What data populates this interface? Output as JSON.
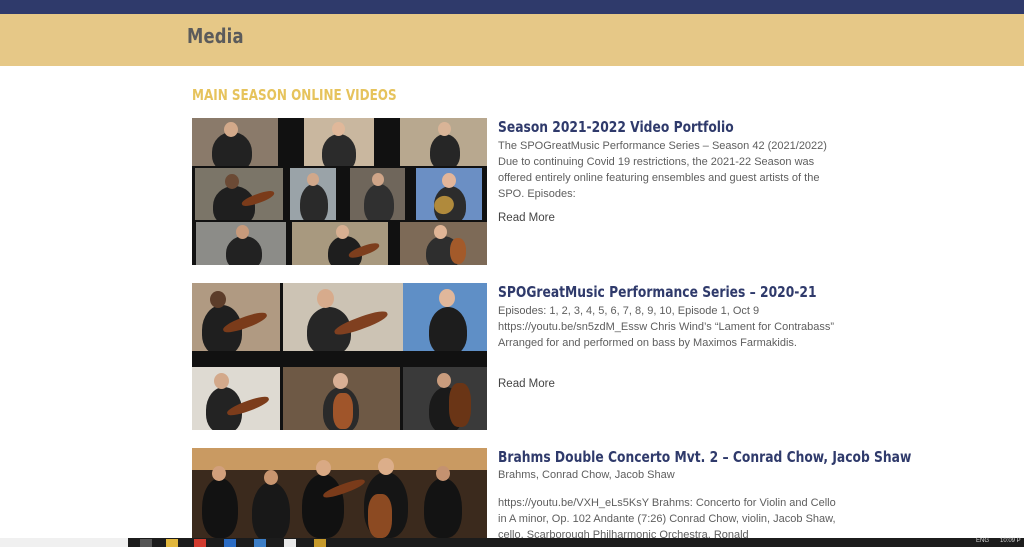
{
  "header": {
    "title": "Media"
  },
  "section": {
    "heading": "MAIN SEASON ONLINE VIDEOS"
  },
  "entries": [
    {
      "title": "Season 2021-2022 Video Portfolio",
      "excerpt": "The SPOGreatMusic Performance Series – Season 42 (2021/2022) Due to continuing Covid 19 restrictions, the 2021-22 Season was offered entirely online featuring ensembles and guest artists of the SPO. Episodes:",
      "read_more": "Read More"
    },
    {
      "title": "SPOGreatMusic Performance Series – 2020-21",
      "excerpt": "Episodes: 1, 2, 3, 4, 5, 6, 7, 8, 9, 10, Episode 1, Oct 9 https://youtu.be/sn5zdM_Essw Chris Wind’s “Lament for Contrabass” Arranged for and performed on bass by Maximos Farmakidis.",
      "read_more": "Read More"
    },
    {
      "title": "Brahms Double Concerto Mvt. 2 – Conrad Chow, Jacob Shaw",
      "subtitle": "Brahms, Conrad Chow, Jacob Shaw",
      "excerpt": "https://youtu.be/VXH_eLs5KsY Brahms: Concerto for Violin and Cello in A minor, Op. 102 Andante (7:26) Conrad Chow, violin, Jacob Shaw, cello, Scarborough Philharmonic Orchestra, Ronald"
    }
  ],
  "taskbar": {
    "lang": "ENG",
    "time": "10:09 P"
  },
  "colors": {
    "accent_navy": "#2f3a6b",
    "header_gold": "#e6c887",
    "heading_gold": "#e6c35c"
  }
}
